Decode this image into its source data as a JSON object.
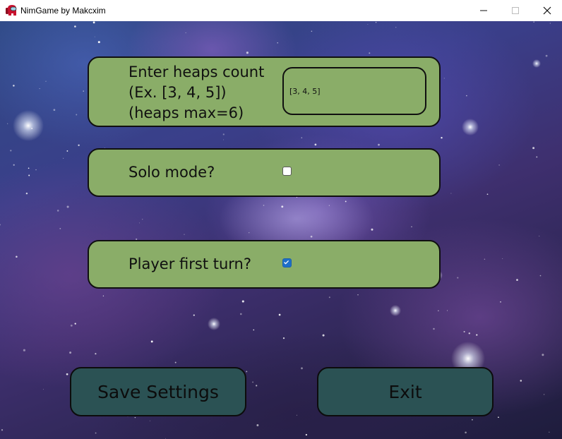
{
  "window": {
    "title": "NimGame by Makcxim",
    "app_icon": "among-us-crewmate-icon",
    "controls": [
      "minimize-icon",
      "maximize-icon",
      "close-icon"
    ]
  },
  "settings": {
    "heaps": {
      "label_lines": [
        "Enter heaps count",
        "(Ex. [3, 4, 5])",
        "(heaps max=6)"
      ],
      "value": "[3, 4, 5]"
    },
    "solo_mode": {
      "label": "Solo mode?",
      "checked": false
    },
    "player_first_turn": {
      "label": "Player first turn?",
      "checked": true
    }
  },
  "actions": {
    "save_label": "Save Settings",
    "exit_label": "Exit"
  },
  "colors": {
    "panel": "#8aad68",
    "button": "#2b5254",
    "checkbox_checked": "#1e6fc8"
  }
}
